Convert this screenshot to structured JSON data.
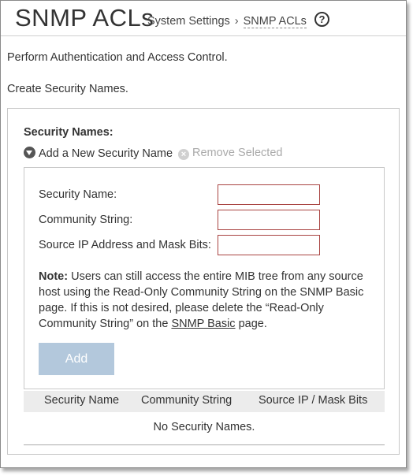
{
  "header": {
    "title": "SNMP ACLs",
    "breadcrumb": {
      "parent": "System Settings",
      "separator": "›",
      "current": "SNMP ACLs"
    },
    "help_icon": "?"
  },
  "intro": {
    "line1": "Perform Authentication and Access Control.",
    "line2": "Create Security Names."
  },
  "section": {
    "title": "Security Names:",
    "add_toggle": "Add a New Security Name",
    "remove": "Remove Selected",
    "remove_icon": "×"
  },
  "form": {
    "security_name_label": "Security Name:",
    "community_string_label": "Community String:",
    "source_ip_label": "Source IP Address and Mask Bits:",
    "security_name_value": "",
    "community_string_value": "",
    "source_ip_value": "",
    "note_label": "Note:",
    "note_text_before": " Users can still access the entire MIB tree from any source host using the Read-Only Community String on the SNMP Basic page. If this is not desired, please delete the “Read-Only Community String” on the ",
    "note_link": "SNMP Basic",
    "note_text_after": " page.",
    "add_button": "Add"
  },
  "table": {
    "columns": [
      "Security Name",
      "Community String",
      "Source IP / Mask Bits"
    ],
    "empty_message": "No Security Names."
  },
  "colors": {
    "add_button_bg": "#b3c8dc",
    "input_border": "#a94442"
  }
}
